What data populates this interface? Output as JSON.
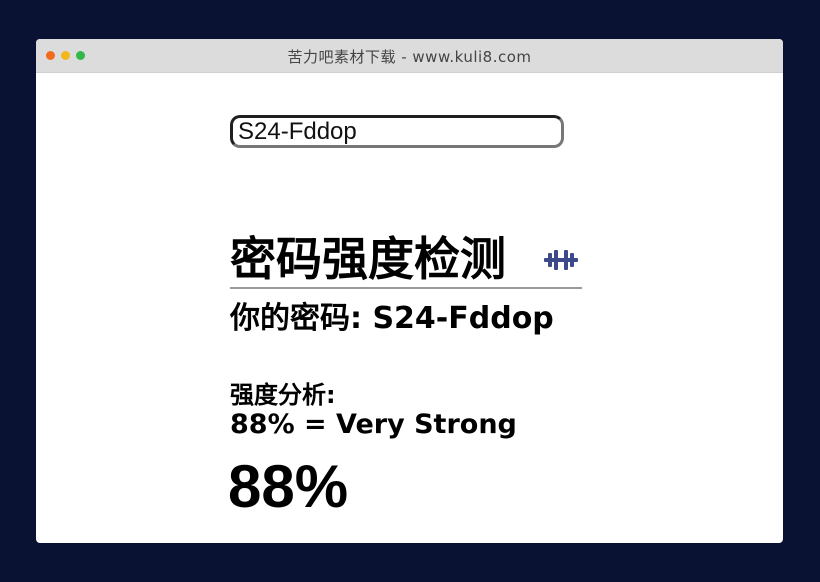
{
  "window": {
    "title": "苦力吧素材下载 - www.kuli8.com"
  },
  "password_input": {
    "value": "S24-Fddop"
  },
  "heading": {
    "title": "密码强度检测",
    "icon": "dumbbell-icon",
    "icon_color": "#3d4a8a"
  },
  "your_password": {
    "label": "你的密码: ",
    "value": "S24-Fddop"
  },
  "analysis": {
    "label": "强度分析:",
    "result": "88% = Very Strong",
    "percent_display": "88%",
    "score_percent": 88
  }
}
